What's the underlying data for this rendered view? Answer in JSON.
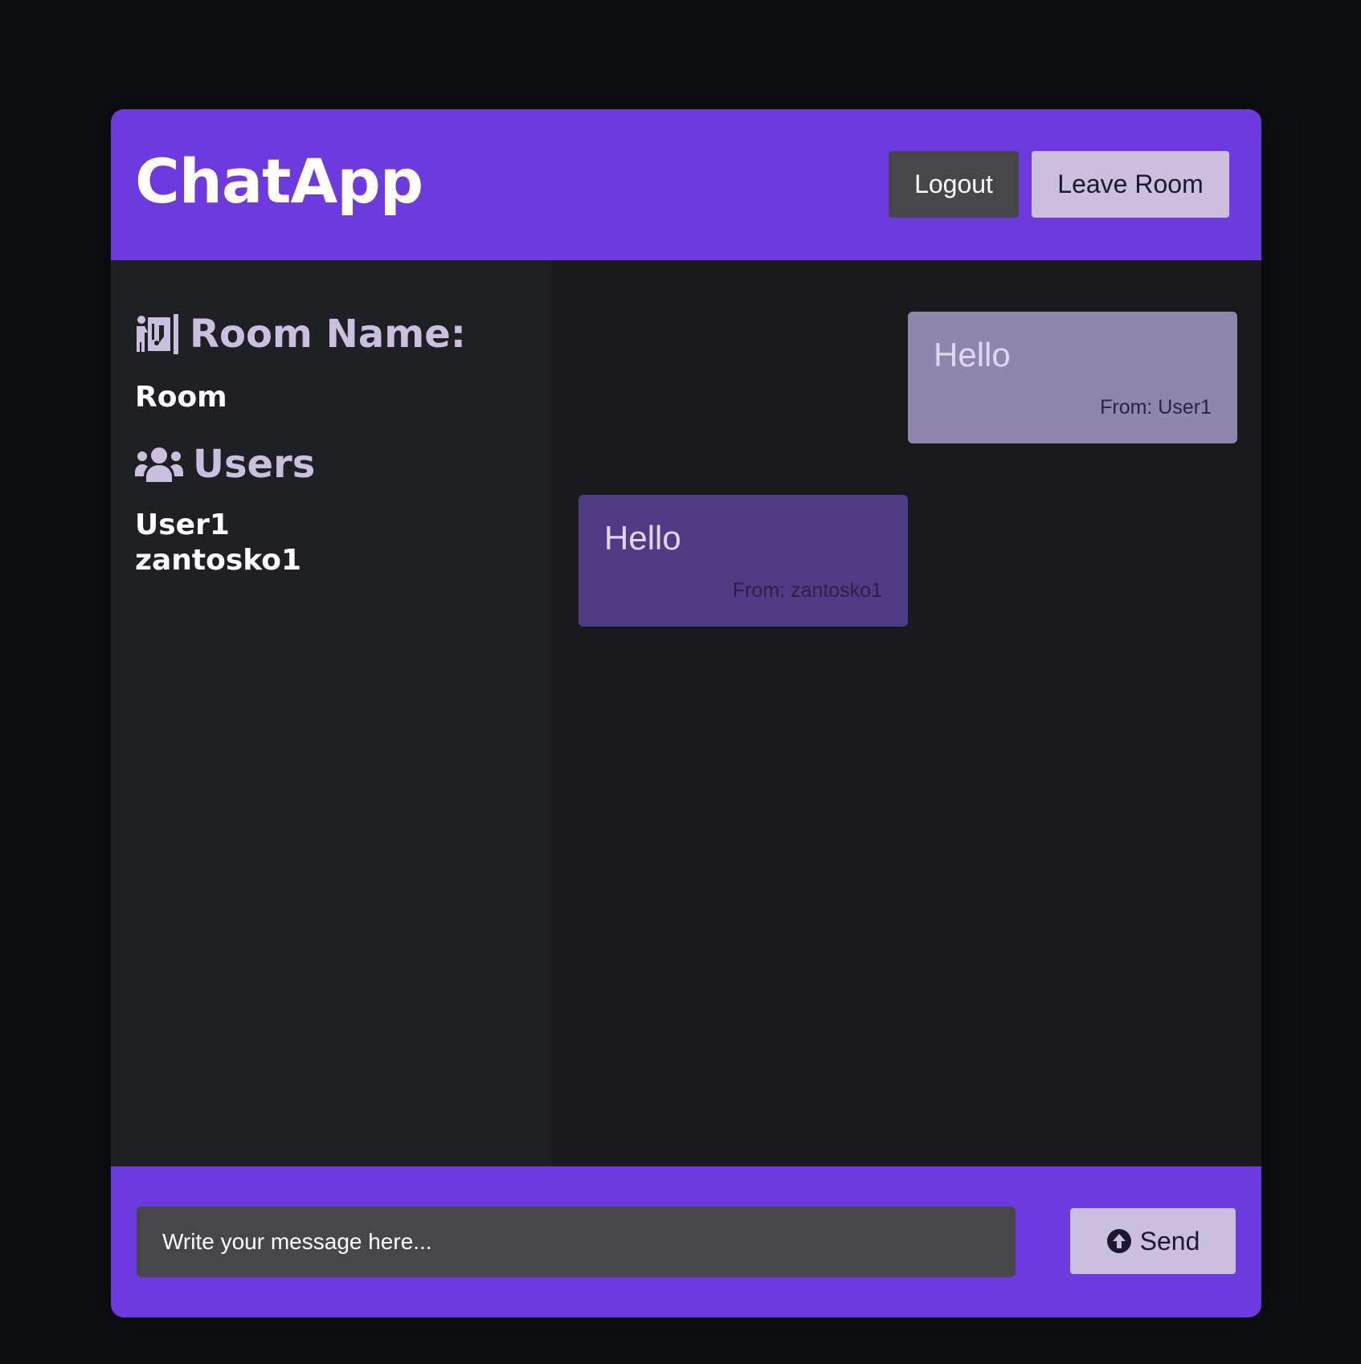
{
  "header": {
    "title": "ChatApp",
    "logout_label": "Logout",
    "leave_label": "Leave Room"
  },
  "sidebar": {
    "room_heading": "Room Name:",
    "room_heading_icon": "door-exit-icon",
    "room_name": "Room",
    "users_heading": "Users",
    "users_heading_icon": "users-group-icon",
    "users": [
      "User1",
      "zantosko1"
    ]
  },
  "messages": [
    {
      "text": "Hello",
      "from": "From: User1",
      "own": true
    },
    {
      "text": "Hello",
      "from": "From: zantosko1",
      "own": false
    }
  ],
  "footer": {
    "input_placeholder": "Write your message here...",
    "input_value": "",
    "send_label": "Send",
    "send_icon": "arrow-up-circle-icon"
  },
  "colors": {
    "accent": "#6d3adf",
    "background": "#0e0f12",
    "sidebar": "#1f2024",
    "chat_area": "#1a1a1d",
    "own_message": "#8f86ad",
    "other_message": "#4f3b86",
    "light_button": "#cbbfe0",
    "dark_button": "#47474b"
  }
}
